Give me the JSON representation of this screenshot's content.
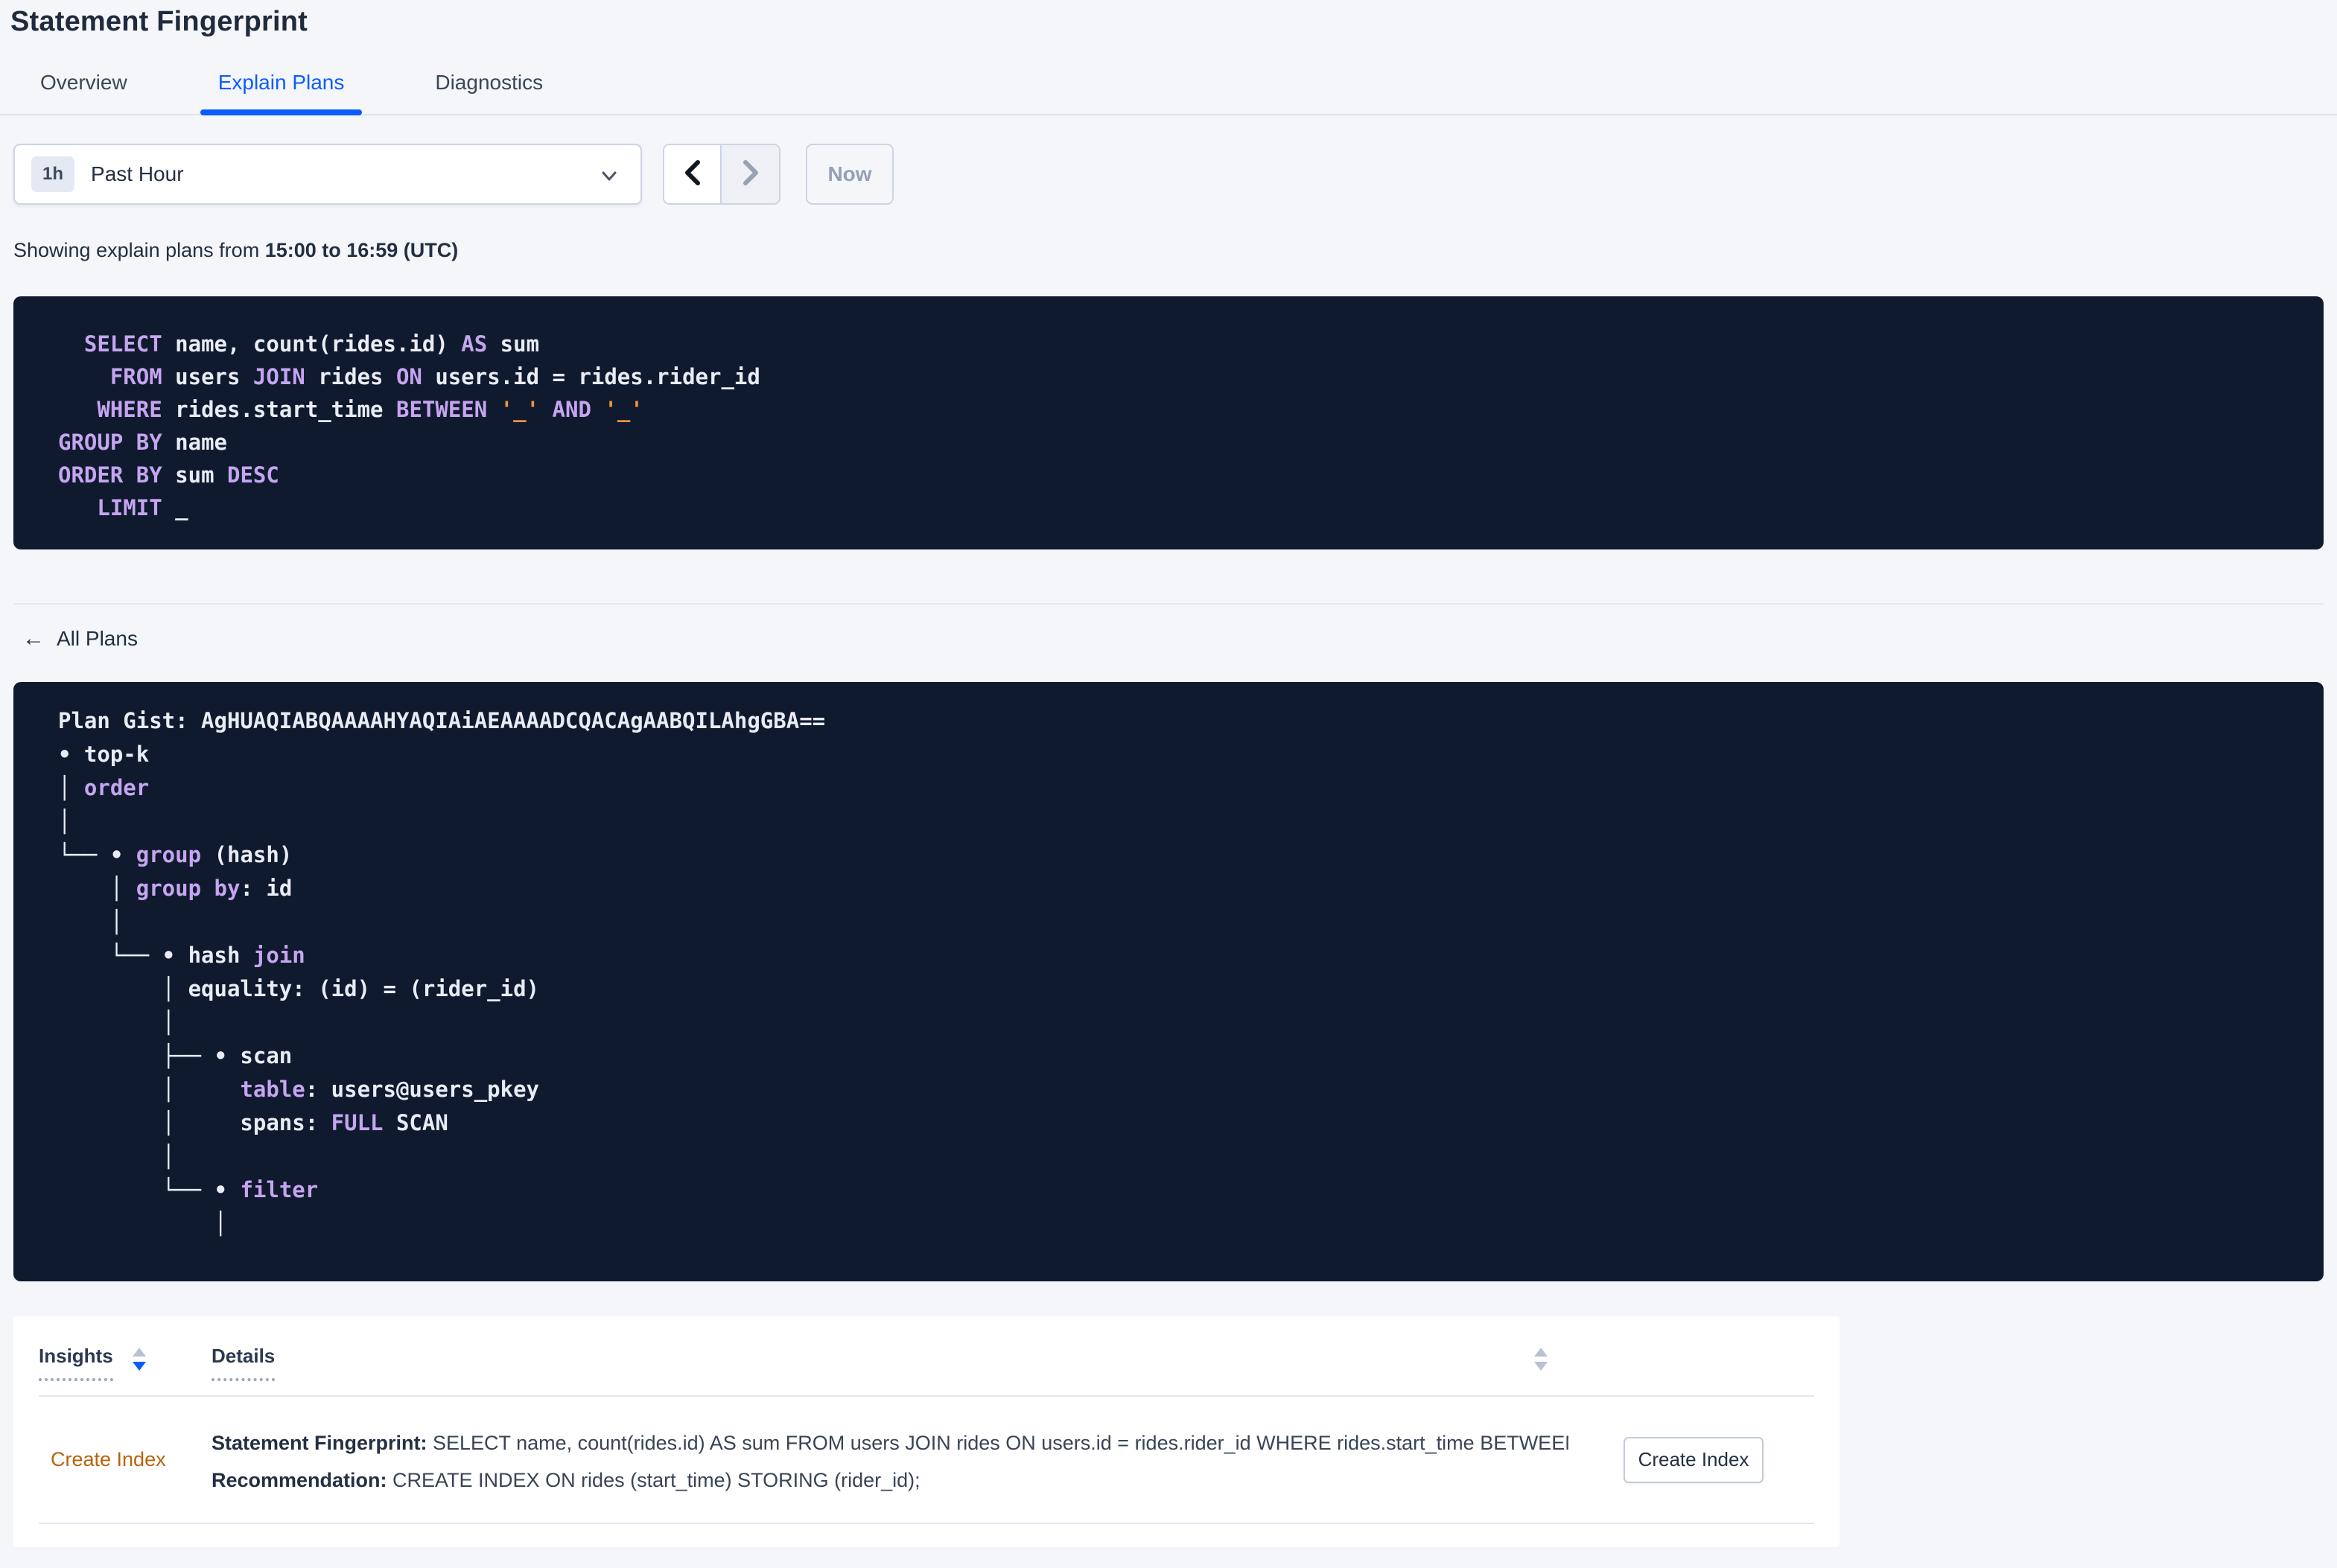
{
  "page": {
    "title": "Statement Fingerprint"
  },
  "tabs": [
    {
      "label": "Overview",
      "active": false
    },
    {
      "label": "Explain Plans",
      "active": true
    },
    {
      "label": "Diagnostics",
      "active": false
    }
  ],
  "time_picker": {
    "badge": "1h",
    "selected": "Past Hour",
    "now_label": "Now"
  },
  "subtitle": {
    "prefix": "Showing explain plans from ",
    "range": "15:00 to 16:59 (UTC)"
  },
  "sql": {
    "lines": [
      [
        [
          "w",
          "  "
        ],
        [
          "k",
          "SELECT"
        ],
        [
          "w",
          " name, count(rides.id) "
        ],
        [
          "k",
          "AS"
        ],
        [
          "w",
          " sum"
        ]
      ],
      [
        [
          "w",
          "    "
        ],
        [
          "k",
          "FROM"
        ],
        [
          "w",
          " users "
        ],
        [
          "k",
          "JOIN"
        ],
        [
          "w",
          " rides "
        ],
        [
          "k",
          "ON"
        ],
        [
          "w",
          " users.id = rides.rider_id"
        ]
      ],
      [
        [
          "w",
          "   "
        ],
        [
          "k",
          "WHERE"
        ],
        [
          "w",
          " rides.start_time "
        ],
        [
          "k",
          "BETWEEN"
        ],
        [
          "w",
          " "
        ],
        [
          "o",
          "'_'"
        ],
        [
          "w",
          " "
        ],
        [
          "k",
          "AND"
        ],
        [
          "w",
          " "
        ],
        [
          "o",
          "'_'"
        ]
      ],
      [
        [
          "k",
          "GROUP BY"
        ],
        [
          "w",
          " name"
        ]
      ],
      [
        [
          "k",
          "ORDER BY"
        ],
        [
          "w",
          " sum "
        ],
        [
          "k",
          "DESC"
        ]
      ],
      [
        [
          "w",
          "   "
        ],
        [
          "k",
          "LIMIT"
        ],
        [
          "w",
          " _"
        ]
      ]
    ]
  },
  "all_plans": {
    "label": "All Plans",
    "arrow": "←"
  },
  "plan": {
    "gist_line": "Plan Gist: AgHUAQIABQAAAAHYAQIAiAEAAAADCQACAgAABQILAhgGBA==",
    "tree_lines": [
      [
        [
          "w",
          ""
        ]
      ],
      [
        [
          "w",
          "• top-k"
        ]
      ],
      [
        [
          "w",
          "│ "
        ],
        [
          "k",
          "order"
        ]
      ],
      [
        [
          "w",
          "│"
        ]
      ],
      [
        [
          "w",
          "└── • "
        ],
        [
          "k",
          "group"
        ],
        [
          "w",
          " (hash)"
        ]
      ],
      [
        [
          "w",
          "    │ "
        ],
        [
          "k",
          "group by"
        ],
        [
          "w",
          ": id"
        ]
      ],
      [
        [
          "w",
          "    │"
        ]
      ],
      [
        [
          "w",
          "    └── • hash "
        ],
        [
          "k",
          "join"
        ]
      ],
      [
        [
          "w",
          "        │ equality: (id) = (rider_id)"
        ]
      ],
      [
        [
          "w",
          "        │"
        ]
      ],
      [
        [
          "w",
          "        ├── • scan"
        ]
      ],
      [
        [
          "w",
          "        │     "
        ],
        [
          "k",
          "table"
        ],
        [
          "w",
          ": users@users_pkey"
        ]
      ],
      [
        [
          "w",
          "        │     spans: "
        ],
        [
          "k",
          "FULL"
        ],
        [
          "w",
          " SCAN"
        ]
      ],
      [
        [
          "w",
          "        │"
        ]
      ],
      [
        [
          "w",
          "        └── • "
        ],
        [
          "k",
          "filter"
        ]
      ],
      [
        [
          "w",
          "            │"
        ]
      ]
    ]
  },
  "insights_table": {
    "columns": {
      "insights": "Insights",
      "details": "Details"
    },
    "row": {
      "insight": "Create Index",
      "fingerprint_label": "Statement Fingerprint: ",
      "fingerprint": "SELECT name, count(rides.id) AS sum FROM users JOIN rides ON users.id = rides.rider_id WHERE rides.start_time BETWEEN '_…",
      "recommendation_label": "Recommendation: ",
      "recommendation": "CREATE INDEX ON rides (start_time) STORING (rider_id);",
      "action_label": "Create Index"
    }
  },
  "colors": {
    "accent_blue": "#0b5cff",
    "code_background": "#101a2e",
    "code_keyword": "#c5a5f0",
    "code_text": "#e9ecf5",
    "code_literal": "#ee9040",
    "insight_orange": "#b86309",
    "page_background": "#f4f6fa"
  }
}
